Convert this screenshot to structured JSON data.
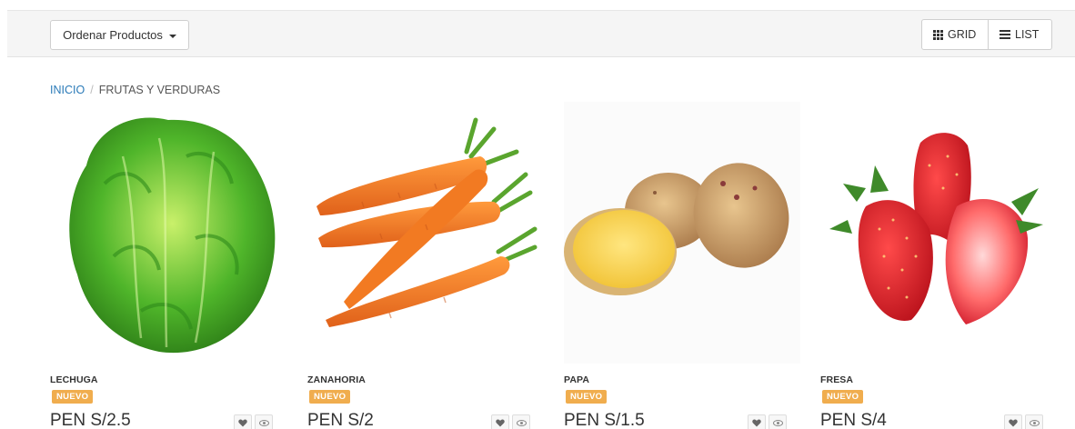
{
  "toolbar": {
    "sort_label": "Ordenar Productos",
    "grid_label": "GRID",
    "list_label": "LIST"
  },
  "breadcrumb": {
    "home": "INICIO",
    "separator": "/",
    "current": "FRUTAS Y VERDURAS"
  },
  "products": [
    {
      "name": "LECHUGA",
      "badge": "NUEVO",
      "price": "PEN S/2.5"
    },
    {
      "name": "ZANAHORIA",
      "badge": "NUEVO",
      "price": "PEN S/2"
    },
    {
      "name": "PAPA",
      "badge": "NUEVO",
      "price": "PEN S/1.5"
    },
    {
      "name": "FRESA",
      "badge": "NUEVO",
      "price": "PEN S/4"
    }
  ],
  "colors": {
    "link": "#2a7ab8",
    "badge": "#f0ad4e",
    "toolbar_bg": "#f5f5f5"
  },
  "icons": [
    "caret-down-icon",
    "grid-icon",
    "list-icon",
    "heart-icon",
    "eye-icon"
  ]
}
